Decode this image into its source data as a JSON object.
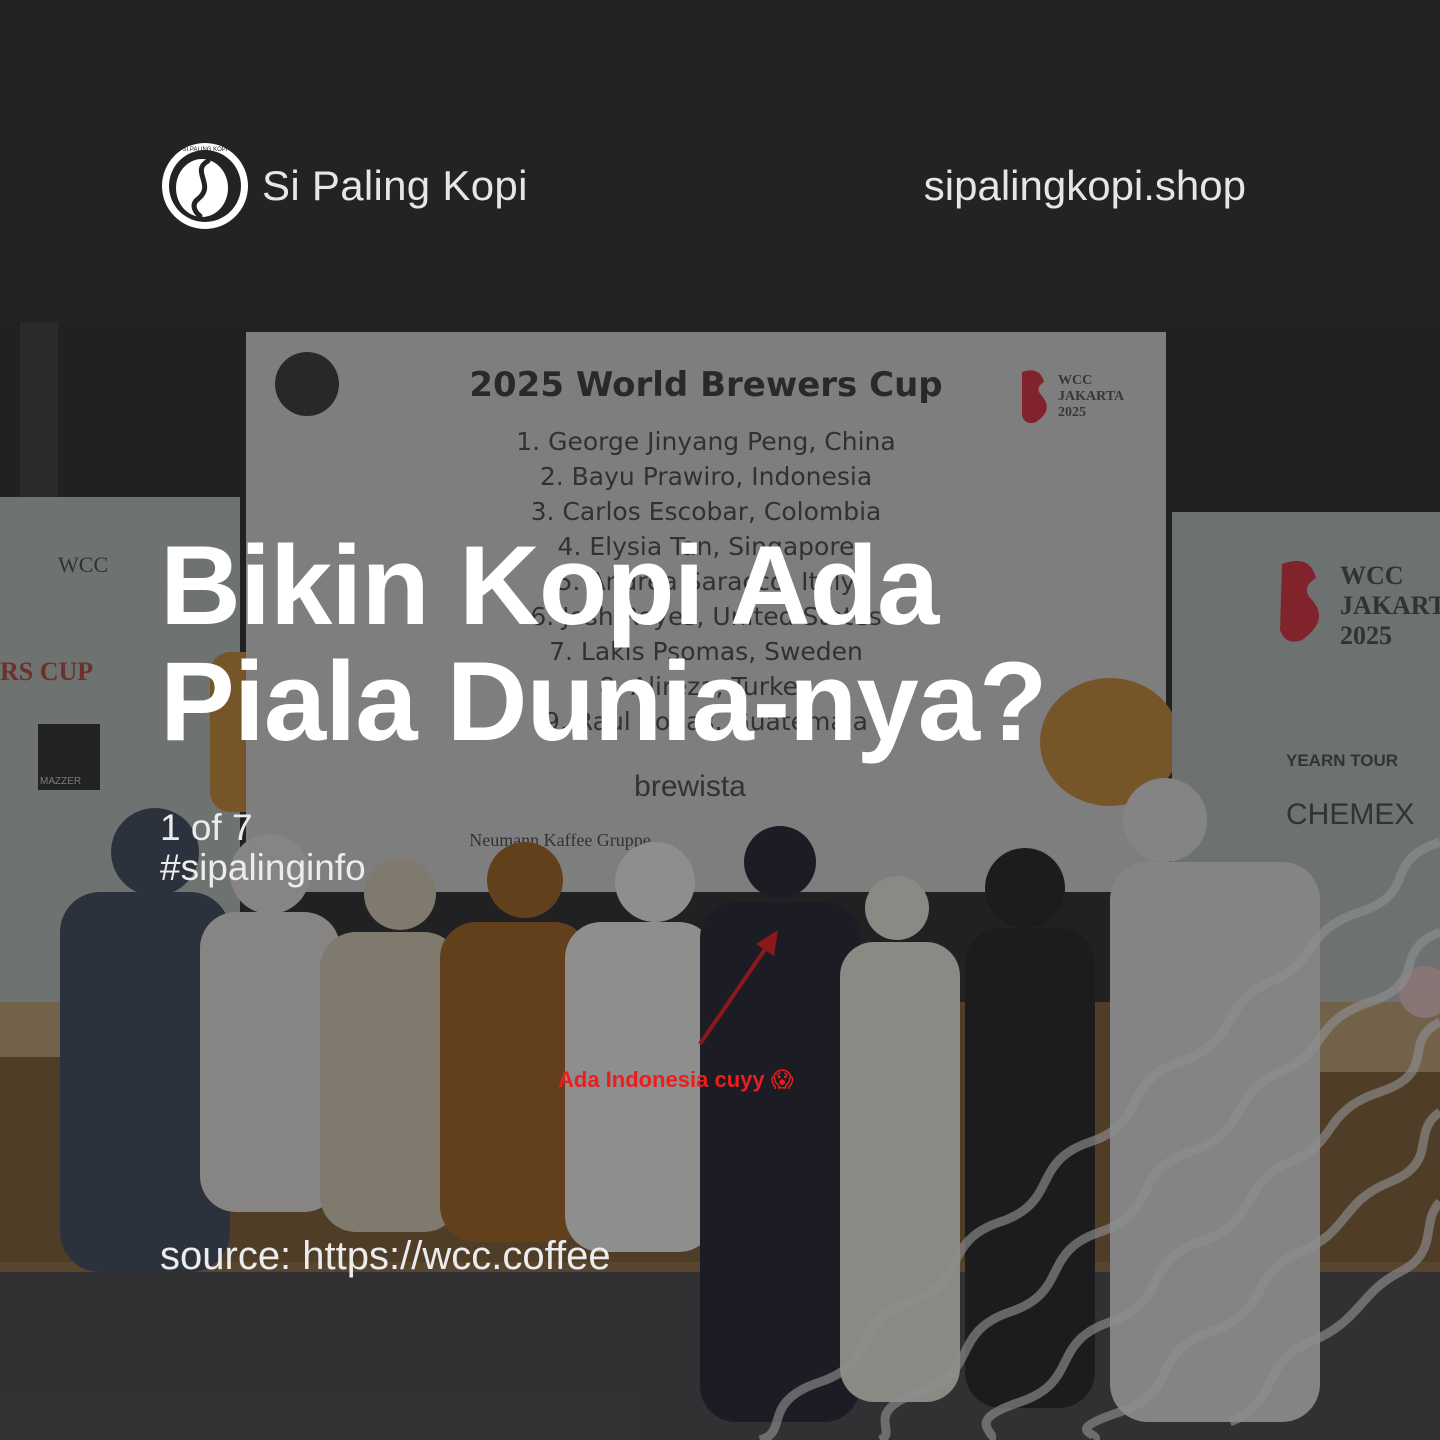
{
  "brand": {
    "name": "Si Paling Kopi",
    "logo_ring_text": "SI PALING KOPI",
    "logo_icon": "coffee-bean-logo-icon"
  },
  "site": {
    "url": "sipalingkopi.shop"
  },
  "post": {
    "headline_line1": "Bikin Kopi Ada",
    "headline_line2": "Piala Dunia-nya?",
    "counter": "1 of 7",
    "hashtag": "#sipalinginfo",
    "source": "source: https://wcc.coffee",
    "annotation": "Ada Indonesia cuyy 😱"
  },
  "photo": {
    "board_title": "2025 World Brewers Cup",
    "rankings": [
      "1. George Jinyang Peng, China",
      "2. Bayu Prawiro, Indonesia",
      "3. Carlos Escobar, Colombia",
      "4. Elysia Tan, Singapore",
      "5. Andrea Saracco, Italy",
      "6. Josh Reyes, United States",
      "7. Lakis Psomas, Sweden",
      "8. Alireza, Turkey",
      "9. Raul Rodas, Guatemala"
    ],
    "event_logo_text_1": "WCC",
    "event_logo_text_2": "JAKARTA",
    "event_logo_text_3": "2025",
    "left_banner_logo": "WCC",
    "left_banner_cup": "RS CUP",
    "left_banner_sponsor": "MAZZER",
    "right_banner_1": "YEARN TOUR",
    "right_banner_2": "CHEMEX",
    "board_sponsor_1": "brewista",
    "board_sponsor_2": "Neumann Kaffee Gruppe",
    "colors": {
      "annotation": "#ee1c1c",
      "event_red": "#d9313e",
      "orange": "#e9a23b"
    }
  }
}
